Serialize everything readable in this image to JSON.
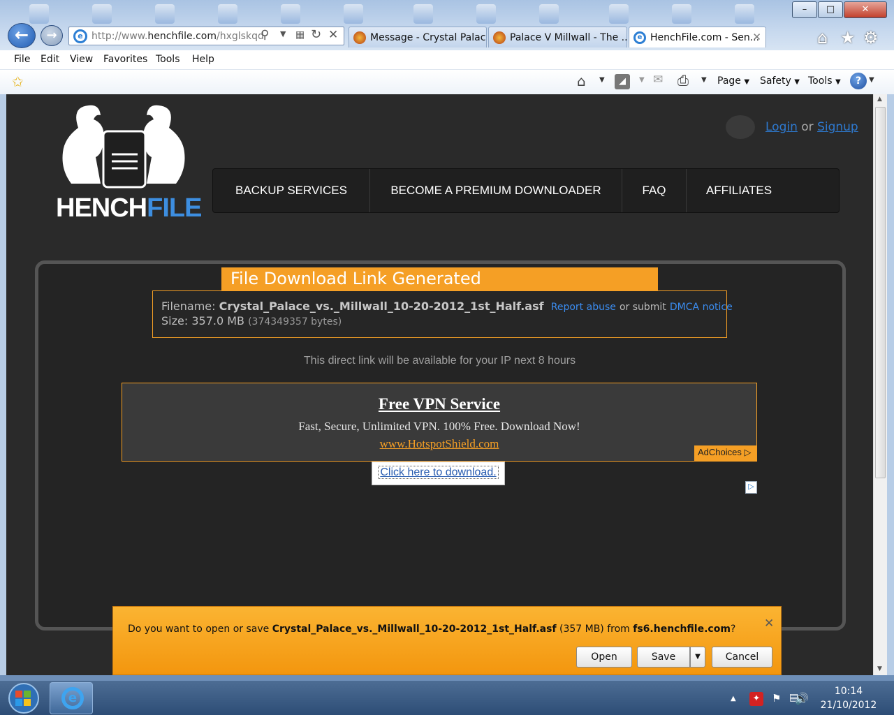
{
  "window": {
    "minimize": "–",
    "maximize": "□",
    "close": "✕"
  },
  "address_bar": {
    "url_prefix": "http://www.",
    "url_domain": "henchfile.com",
    "url_suffix": "/hxglskqd"
  },
  "tabs": [
    {
      "label": "Message - Crystal Palac...",
      "icon": "firefox-like-icon",
      "active": false
    },
    {
      "label": "Palace V Millwall - The ...",
      "icon": "firefox-like-icon",
      "active": false
    },
    {
      "label": "HenchFile.com - Sen...",
      "icon": "ie-icon",
      "active": true
    }
  ],
  "menu": [
    "File",
    "Edit",
    "View",
    "Favorites",
    "Tools",
    "Help"
  ],
  "command_bar": {
    "page": "Page",
    "safety": "Safety",
    "tools": "Tools"
  },
  "site": {
    "logo_part1": "HENCH",
    "logo_part2": "FILE",
    "login": "Login",
    "or": "or",
    "signup": "Signup",
    "nav": [
      "BACKUP SERVICES",
      "BECOME A PREMIUM DOWNLOADER",
      "FAQ",
      "AFFILIATES"
    ]
  },
  "download": {
    "heading": "File Download Link Generated",
    "filename_label": "Filename:",
    "filename": "Crystal_Palace_vs._Millwall_10-20-2012_1st_Half.asf",
    "report_abuse": "Report abuse",
    "or_submit": "or submit",
    "dmca": "DMCA notice",
    "size_label": "Size:",
    "size": "357.0 MB",
    "size_bytes": "(374349357 bytes)",
    "availability": "This direct link will be available for your IP next 8 hours",
    "click_here": "Click here to download."
  },
  "ad": {
    "title": "Free VPN Service",
    "description": "Fast, Secure, Unlimited VPN. 100% Free. Download Now!",
    "link": "www.HotspotShield.com",
    "adchoices": "AdChoices"
  },
  "notification": {
    "prefix": "Do you want to open or save",
    "filename": "Crystal_Palace_vs._Millwall_10-20-2012_1st_Half.asf",
    "size": "(357 MB) from",
    "host": "fs6.henchfile.com",
    "suffix": "?",
    "open": "Open",
    "save": "Save",
    "cancel": "Cancel"
  },
  "taskbar": {
    "time": "10:14",
    "date": "21/10/2012"
  },
  "colors": {
    "accent_orange": "#f59f25",
    "link_blue": "#2e79cf",
    "page_bg": "#2a2a2a"
  }
}
